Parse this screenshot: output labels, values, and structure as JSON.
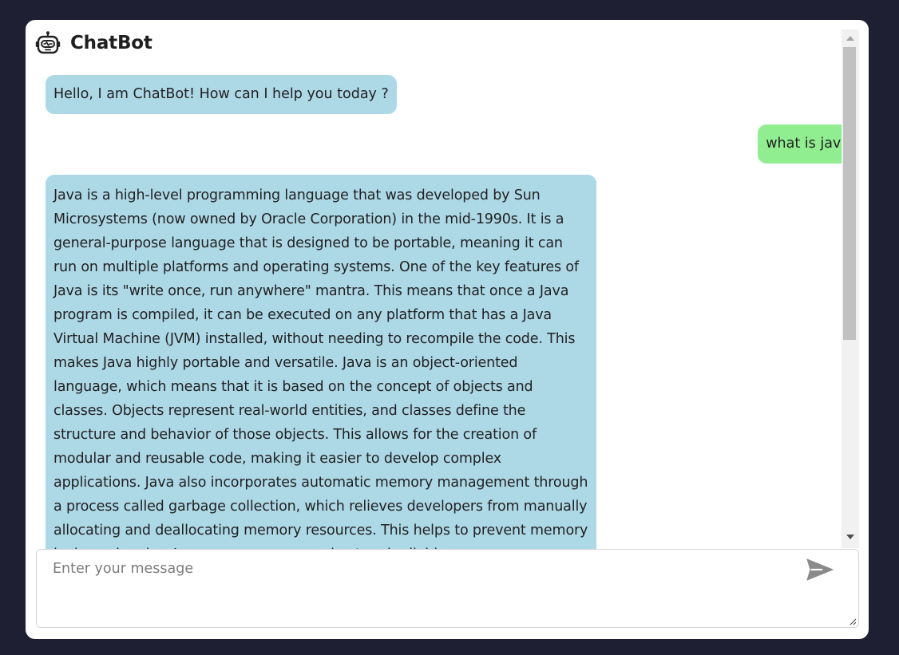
{
  "app": {
    "title": "ChatBot",
    "icon": "robot-icon"
  },
  "messages": [
    {
      "role": "bot",
      "text": "Hello, I am ChatBot! How can I help you today ?"
    },
    {
      "role": "user",
      "text": "what is java"
    },
    {
      "role": "bot",
      "text": "Java is a high-level programming language that was developed by Sun Microsystems (now owned by Oracle Corporation) in the mid-1990s. It is a general-purpose language that is designed to be portable, meaning it can run on multiple platforms and operating systems. One of the key features of Java is its \"write once, run anywhere\" mantra. This means that once a Java program is compiled, it can be executed on any platform that has a Java Virtual Machine (JVM) installed, without needing to recompile the code. This makes Java highly portable and versatile. Java is an object-oriented language, which means that it is based on the concept of objects and classes. Objects represent real-world entities, and classes define the structure and behavior of those objects. This allows for the creation of modular and reusable code, making it easier to develop complex applications. Java also incorporates automatic memory management through a process called garbage collection, which relieves developers from manually allocating and deallocating memory resources. This helps to prevent memory leaks and makes Java programs more robust and reliable."
    }
  ],
  "composer": {
    "placeholder": "Enter your message",
    "send_icon": "send-icon"
  },
  "colors": {
    "page_background": "#1f1f33",
    "panel_background": "#ffffff",
    "bot_bubble": "#add8e6",
    "user_bubble": "#90ee90",
    "send_icon": "#8a8a8a"
  }
}
